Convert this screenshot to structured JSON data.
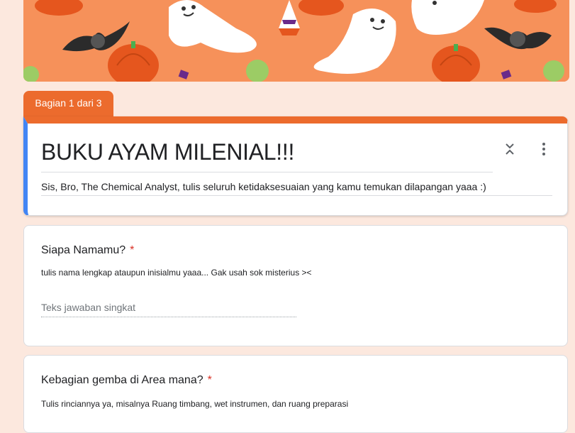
{
  "section_tab": {
    "label": "Bagian 1 dari 3"
  },
  "colors": {
    "theme": "#ec6b2d",
    "accent_left": "#4285f4",
    "background": "#fce8de",
    "banner": "#f6915a"
  },
  "icons": {
    "collapse": "collapse-icon",
    "more": "more-vert-icon"
  },
  "form": {
    "title": "BUKU AYAM MILENIAL!!!",
    "description": "Sis, Bro, The Chemical Analyst,  tulis seluruh ketidaksesuaian yang kamu temukan dilapangan yaaa :)"
  },
  "questions": [
    {
      "title": "Siapa Namamu?",
      "required_mark": "*",
      "help": "tulis nama lengkap ataupun inisialmu yaaa... Gak usah sok misterius ><",
      "placeholder": "Teks jawaban singkat",
      "value": ""
    },
    {
      "title": "Kebagian gemba di Area mana?",
      "required_mark": "*",
      "help": "Tulis rinciannya ya, misalnya Ruang timbang, wet instrumen, dan ruang preparasi"
    }
  ]
}
